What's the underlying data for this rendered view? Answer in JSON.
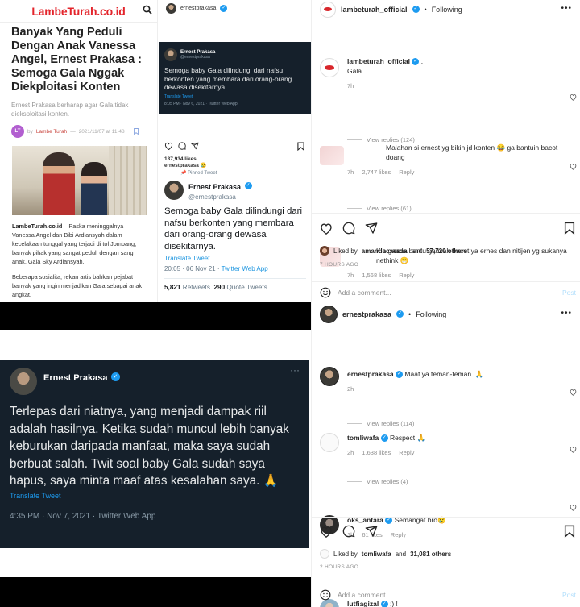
{
  "news": {
    "site_name": "LambeTurah.co.id",
    "title": "Banyak Yang Peduli Dengan Anak Vanessa Angel, Ernest Prakasa : Semoga Gala Nggak Diekploitasi Konten",
    "lead": "Ernest Prakasa berharap agar Gala tidak dieksploitasi konten.",
    "author_initials": "LT",
    "by": "by",
    "author": "Lambe Turah",
    "date": "2021/11/07 at 11:48",
    "body_1_source": "LambeTurah.co.id",
    "body_1": " – Paska meninggalnya Vanessa Angel dan Bibi Ardiansyah dalam kecelakaan tunggal yang terjadi di tol Jombang, banyak pihak yang sangat peduli dengan sang anak, Gala Sky Ardiansyah.",
    "body_2": "Beberapa sosialita, rekan artis bahkan pejabat banyak yang ingin menjadikan Gala sebagai anak angkat."
  },
  "ig_post": {
    "username": "ernestprakasa",
    "embed": {
      "name": "Ernest Prakasa",
      "handle": "@ernestprakasa",
      "text": "Semoga baby Gala dilindungi dari nafsu berkonten yang membara dari orang-orang dewasa disekitarnya.",
      "translate": "Translate Tweet",
      "meta": "8:05 PM · Nov 6, 2021 · Twitter Web App"
    },
    "likes": "137,934 likes",
    "caption_user": "ernestprakasa",
    "caption_emoji": "😢",
    "pinned": "Pinned Tweet",
    "tweet": {
      "name": "Ernest Prakasa",
      "handle": "@ernestprakasa",
      "text": "Semoga baby Gala dilindungi dari nafsu berkonten yang membara dari orang-orang dewasa disekitarnya.",
      "translate": "Translate Tweet",
      "time": "20:05 · 06 Nov 21 · ",
      "app": "Twitter Web App",
      "retweets_count": "5,821",
      "retweets_label": "Retweets",
      "quotes_count": "290",
      "quotes_label": "Quote Tweets"
    }
  },
  "lambe_post": {
    "username": "lambeturah_official",
    "following": "Following",
    "caption_user": "lambeturah_official",
    "caption_suffix": ".",
    "caption_text": "Gala..",
    "caption_time": "7h",
    "comments": [
      {
        "text": "Malahan si ernest yg bikin jd konten 😂 ga bantuin bacot doang",
        "time": "7h",
        "likes": "2,747 likes",
        "reply": "Reply",
        "replies": "View replies (124)"
      },
      {
        "text": "Klo gaada bantu gausah bacot ya ernes dan nitijen yg sukanya nethink 😁",
        "time": "7h",
        "likes": "1,568 likes",
        "reply": "Reply",
        "replies": "View replies (61)"
      }
    ],
    "liked_by_prefix": "Liked by",
    "liked_by_user": "amandacaesaa",
    "liked_by_and": "and",
    "liked_by_others": "57,720 others",
    "ago": "7 HOURS AGO",
    "add_comment": "Add a comment...",
    "post_btn": "Post"
  },
  "ernest_post": {
    "username": "ernestprakasa",
    "following": "Following",
    "caption_user": "ernestprakasa",
    "caption_text": "Maaf ya teman-teman. 🙏",
    "caption_time": "2h",
    "comments": [
      {
        "user": "tomliwafa",
        "text": "Respect 🙏",
        "time": "2h",
        "likes": "1,638 likes",
        "reply": "Reply",
        "replies": "View replies (114)"
      },
      {
        "user": "oks_antara",
        "text": "Semangat bro😢",
        "time": "1h",
        "likes": "61 likes",
        "reply": "Reply",
        "replies": "View replies (4)"
      },
      {
        "user": "lutfiagizal",
        "text": ";) !"
      }
    ],
    "liked_by_prefix": "Liked by",
    "liked_by_user": "tomliwafa",
    "liked_by_and": "and",
    "liked_by_others": "31,081 others",
    "ago": "2 HOURS AGO",
    "add_comment": "Add a comment...",
    "post_btn": "Post"
  },
  "dark_tweet": {
    "name": "Ernest Prakasa",
    "handle": "@ernestprakasa",
    "text": "Terlepas dari niatnya, yang menjadi dampak riil adalah hasilnya. Ketika sudah muncul lebih banyak keburukan daripada manfaat, maka saya sudah berbuat salah. Twit soal baby Gala sudah saya hapus, saya minta maaf atas kesalahan saya. 🙏",
    "translate": "Translate Tweet",
    "meta": "4:35 PM · Nov 7, 2021 · Twitter Web App",
    "more": "···"
  }
}
